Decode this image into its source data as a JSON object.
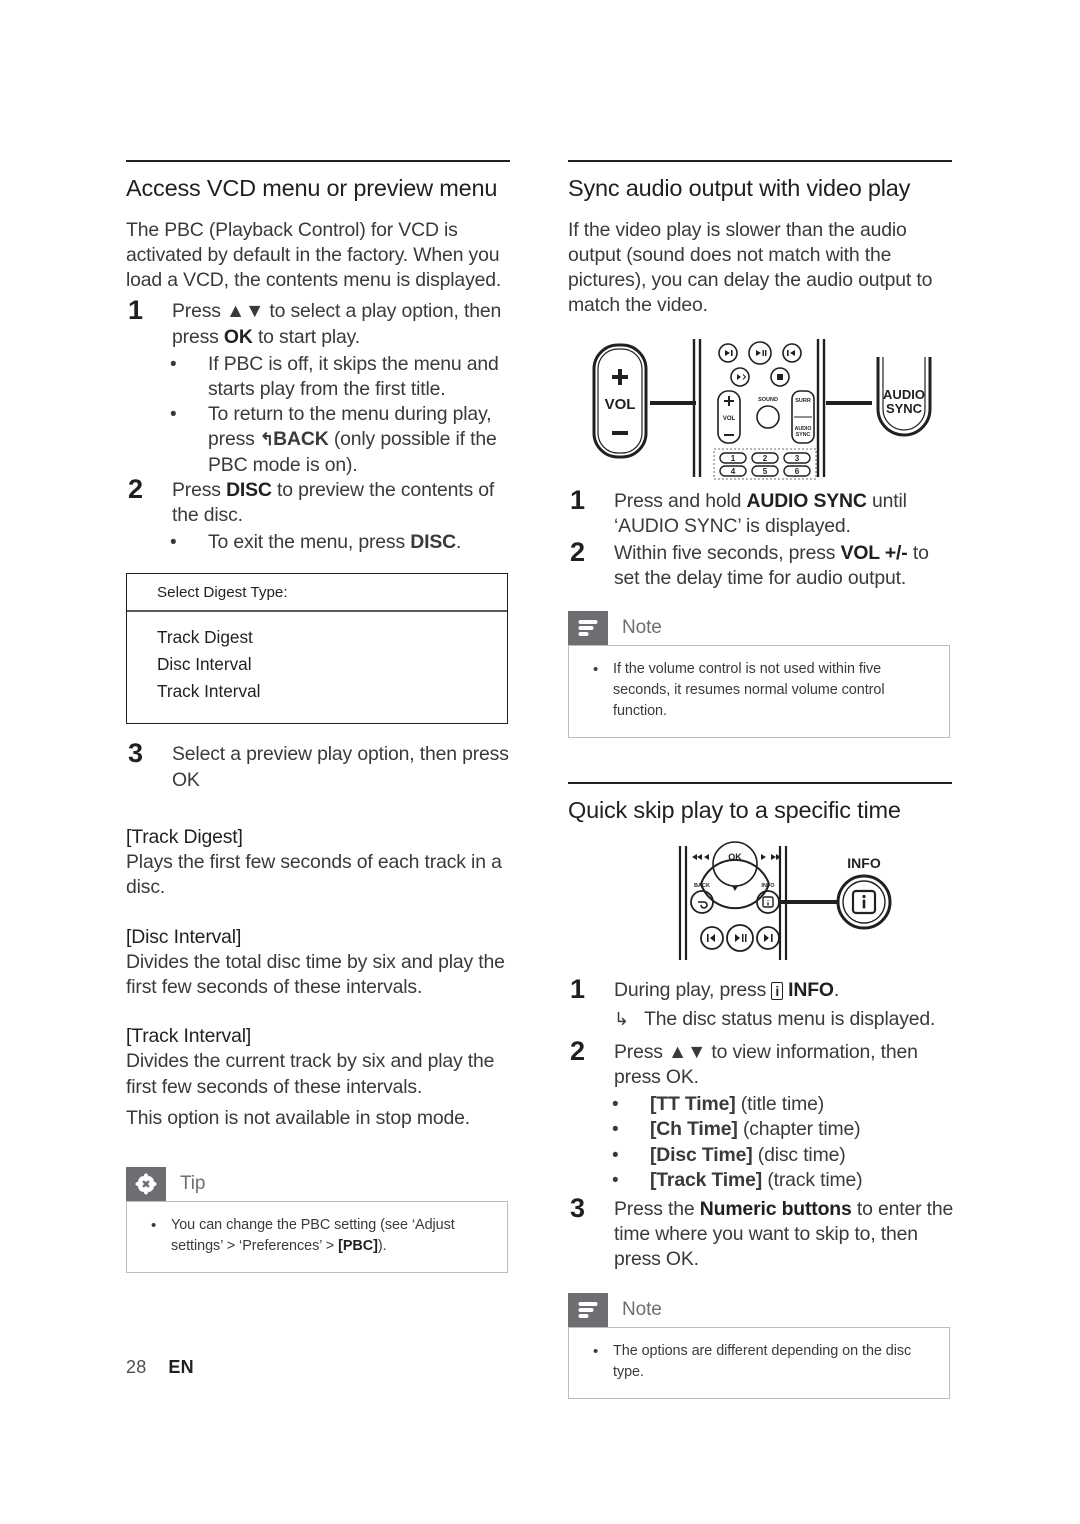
{
  "page": {
    "number": "28",
    "language": "EN"
  },
  "left_column": {
    "section": {
      "title": "Access VCD menu or preview menu",
      "intro": "The PBC (Playback Control) for VCD is activated by default in the factory. When you load a VCD, the contents menu is displayed.",
      "steps": [
        {
          "num": "1",
          "text_before": "Press ▲▼ to select a play option, then press ",
          "text_bold": "OK",
          "text_after": " to start play.",
          "bullets": [
            {
              "text": "If PBC is off, it skips the menu and starts play from the first title."
            },
            {
              "text_before": "To return to the menu during play, press ",
              "glyph": "↰",
              "text_bold": "BACK",
              "text_after": " (only possible if the PBC mode is on)."
            }
          ]
        },
        {
          "num": "2",
          "text_before": "Press ",
          "text_bold": "DISC",
          "text_after": " to preview the contents of the disc.",
          "bullets": [
            {
              "text_before": "To exit the menu, press ",
              "text_bold": "DISC",
              "text_after": "."
            }
          ]
        },
        {
          "num": "3",
          "text_before": "Select a preview play option, then press OK",
          "text_bold": "",
          "text_after": ""
        }
      ]
    },
    "osd_menu": {
      "header": "Select Digest Type:",
      "items": [
        "Track Digest",
        "Disc Interval",
        "Track Interval"
      ]
    },
    "definitions": [
      {
        "term": "[Track Digest]",
        "desc": "Plays the first few seconds of each track in a disc."
      },
      {
        "term": "[Disc Interval]",
        "desc": "Divides the total disc time by six and play the first few seconds of these intervals."
      },
      {
        "term": "[Track Interval]",
        "desc": "Divides the current track by six and play the first few seconds of these intervals.",
        "desc2": "This option is not available in stop mode."
      }
    ],
    "tip": {
      "icon": "asterisk-icon",
      "label": "Tip",
      "bullet_before": "You can change the PBC setting (see ‘Adjust settings’ > ‘Preferences’ > ",
      "bullet_bold": "[PBC]",
      "bullet_after": ")."
    }
  },
  "right_column": {
    "section_sync": {
      "title": "Sync audio output with video play",
      "intro": "If the video play is slower than the audio output (sound does not match with the pictures), you can delay the audio output to match the video.",
      "figure": {
        "name": "remote-audio-sync-figure",
        "callout_left_label": "VOL",
        "callout_left_plus": "+",
        "callout_left_minus": "—",
        "callout_right_line1": "AUDIO",
        "callout_right_line2": "SYNC",
        "remote_vol_label": "VOL",
        "remote_sound_label": "SOUND",
        "remote_surr_label": "SURR",
        "remote_audiosync_line1": "AUDIO",
        "remote_audiosync_line2": "SYNC",
        "numeric_buttons": [
          "1",
          "2",
          "3",
          "4",
          "5",
          "6"
        ]
      },
      "steps": [
        {
          "num": "1",
          "text_before": "Press and hold ",
          "text_bold": "AUDIO SYNC",
          "text_after": " until ‘AUDIO SYNC’ is displayed."
        },
        {
          "num": "2",
          "text_before": "Within five seconds, press ",
          "text_bold": "VOL +/-",
          "text_after": " to set the delay time for audio output."
        }
      ],
      "note": {
        "icon": "note-lines-icon",
        "label": "Note",
        "bullet": "If the volume control is not used within five seconds, it resumes normal volume control function."
      }
    },
    "section_skip": {
      "title": "Quick skip play to a specific time",
      "figure": {
        "name": "remote-info-figure",
        "ok_label": "OK",
        "back_label": "BACK",
        "info_label": "INFO",
        "callout_label": "INFO",
        "callout_glyph": "i"
      },
      "steps": [
        {
          "num": "1",
          "text_before": "During play, press ",
          "glyph": "i",
          "text_bold": "INFO",
          "text_after": ".",
          "arrow_text": "The disc status menu is displayed."
        },
        {
          "num": "2",
          "text_before": "Press ▲▼ to view information, then press OK.",
          "bullets": [
            {
              "bold": "[TT Time]",
              "plain": " (title time)"
            },
            {
              "bold": "[Ch Time]",
              "plain": " (chapter time)"
            },
            {
              "bold": "[Disc Time]",
              "plain": " (disc time)"
            },
            {
              "bold": "[Track Time]",
              "plain": " (track time)"
            }
          ]
        },
        {
          "num": "3",
          "text_before": "Press the ",
          "text_bold": "Numeric buttons",
          "text_after": " to enter the time where you want to skip to, then press OK."
        }
      ],
      "note": {
        "icon": "note-lines-icon",
        "label": "Note",
        "bullet": "The options are different depending on the disc type."
      }
    }
  },
  "colors": {
    "text": "#231f20",
    "body_text": "#3a3a3c",
    "callout_gray": "#6d6e71",
    "callout_border": "#bcbec0"
  }
}
